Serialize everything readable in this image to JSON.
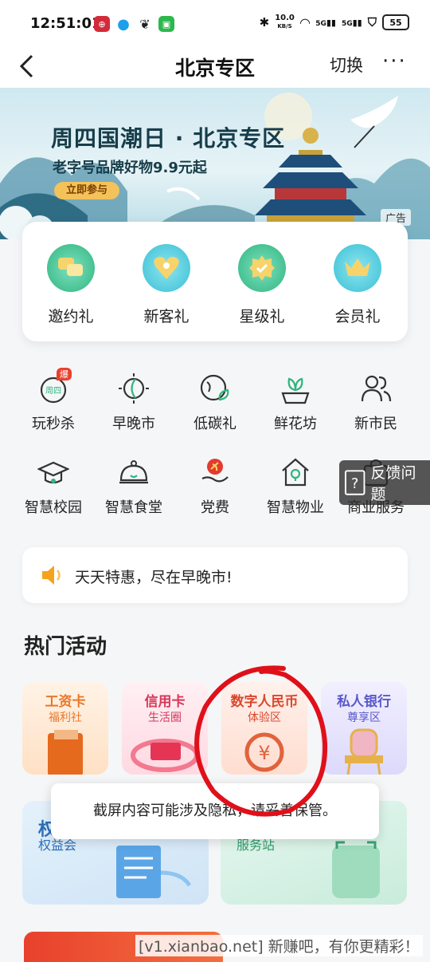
{
  "status_bar": {
    "time": "12:51:01",
    "net_speed_value": "10.0",
    "net_speed_unit": "KB/S",
    "signal1_label": "5G",
    "signal2_label": "5G",
    "battery": "55"
  },
  "nav": {
    "title": "北京专区",
    "switch_label": "切换",
    "more_label": "···"
  },
  "banner": {
    "title": "周四国潮日 · 北京专区",
    "subtitle": "老字号品牌好物9.9元起",
    "cta": "立即参与",
    "ad_label": "广告"
  },
  "gifts": [
    {
      "label": "邀约礼",
      "icon": "chat-bubbles-icon"
    },
    {
      "label": "新客礼",
      "icon": "heart-person-icon"
    },
    {
      "label": "星级礼",
      "icon": "star-badge-icon"
    },
    {
      "label": "会员礼",
      "icon": "crown-icon"
    }
  ],
  "services_row1": [
    {
      "label": "玩秒杀",
      "icon": "flash-sale-clock-icon",
      "tag": "爆",
      "clock_text": "周四"
    },
    {
      "label": "早晚市",
      "icon": "sun-moon-icon"
    },
    {
      "label": "低碳礼",
      "icon": "earth-leaf-icon"
    },
    {
      "label": "鲜花坊",
      "icon": "flower-pot-icon"
    },
    {
      "label": "新市民",
      "icon": "people-icon"
    }
  ],
  "services_row2": [
    {
      "label": "智慧校园",
      "icon": "graduation-cap-icon"
    },
    {
      "label": "智慧食堂",
      "icon": "dish-cover-icon"
    },
    {
      "label": "党费",
      "icon": "party-emblem-hand-icon"
    },
    {
      "label": "智慧物业",
      "icon": "house-bulb-icon"
    },
    {
      "label": "商业服务",
      "icon": "shopping-bag-icon"
    }
  ],
  "feedback": {
    "label": "反馈问题",
    "icon": "question-doc-icon"
  },
  "notice": {
    "text": "天天特惠，尽在早晚市!",
    "icon": "speaker-icon"
  },
  "hot_section_title": "热门活动",
  "activities": [
    {
      "title": "工资卡",
      "subtitle": "福利社",
      "color": "#e8782a"
    },
    {
      "title": "信用卡",
      "subtitle": "生活圈",
      "color": "#d6385a"
    },
    {
      "title": "数字人民币",
      "subtitle": "体验区",
      "color": "#d9472b"
    },
    {
      "title": "私人银行",
      "subtitle": "尊享区",
      "color": "#5a58c9"
    }
  ],
  "promos": [
    {
      "title": "权",
      "subtitle": "权益会"
    },
    {
      "title": "",
      "subtitle": "服务站"
    }
  ],
  "toast": {
    "text": "截屏内容可能涉及隐私，请妥善保管。"
  },
  "watermark": "[v1.xianbao.net] 新赚吧，有你更精彩！",
  "colors": {
    "brand_green": "#2fb57f",
    "accent_red": "#e8412c",
    "annotation_red": "#e0101a"
  }
}
